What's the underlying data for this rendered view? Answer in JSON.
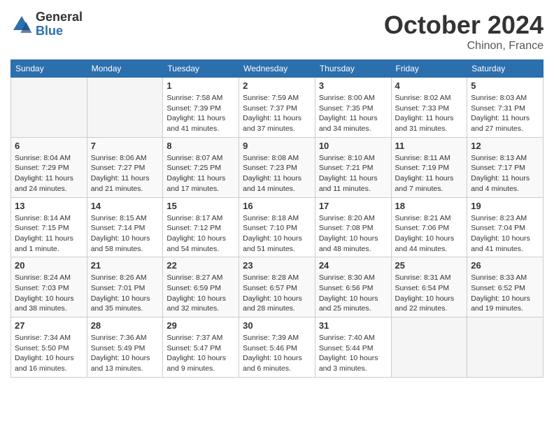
{
  "header": {
    "logo_general": "General",
    "logo_blue": "Blue",
    "month_year": "October 2024",
    "location": "Chinon, France"
  },
  "days_of_week": [
    "Sunday",
    "Monday",
    "Tuesday",
    "Wednesday",
    "Thursday",
    "Friday",
    "Saturday"
  ],
  "weeks": [
    [
      {
        "day": "",
        "empty": true
      },
      {
        "day": "",
        "empty": true
      },
      {
        "day": "1",
        "sunrise": "Sunrise: 7:58 AM",
        "sunset": "Sunset: 7:39 PM",
        "daylight": "Daylight: 11 hours and 41 minutes."
      },
      {
        "day": "2",
        "sunrise": "Sunrise: 7:59 AM",
        "sunset": "Sunset: 7:37 PM",
        "daylight": "Daylight: 11 hours and 37 minutes."
      },
      {
        "day": "3",
        "sunrise": "Sunrise: 8:00 AM",
        "sunset": "Sunset: 7:35 PM",
        "daylight": "Daylight: 11 hours and 34 minutes."
      },
      {
        "day": "4",
        "sunrise": "Sunrise: 8:02 AM",
        "sunset": "Sunset: 7:33 PM",
        "daylight": "Daylight: 11 hours and 31 minutes."
      },
      {
        "day": "5",
        "sunrise": "Sunrise: 8:03 AM",
        "sunset": "Sunset: 7:31 PM",
        "daylight": "Daylight: 11 hours and 27 minutes."
      }
    ],
    [
      {
        "day": "6",
        "sunrise": "Sunrise: 8:04 AM",
        "sunset": "Sunset: 7:29 PM",
        "daylight": "Daylight: 11 hours and 24 minutes."
      },
      {
        "day": "7",
        "sunrise": "Sunrise: 8:06 AM",
        "sunset": "Sunset: 7:27 PM",
        "daylight": "Daylight: 11 hours and 21 minutes."
      },
      {
        "day": "8",
        "sunrise": "Sunrise: 8:07 AM",
        "sunset": "Sunset: 7:25 PM",
        "daylight": "Daylight: 11 hours and 17 minutes."
      },
      {
        "day": "9",
        "sunrise": "Sunrise: 8:08 AM",
        "sunset": "Sunset: 7:23 PM",
        "daylight": "Daylight: 11 hours and 14 minutes."
      },
      {
        "day": "10",
        "sunrise": "Sunrise: 8:10 AM",
        "sunset": "Sunset: 7:21 PM",
        "daylight": "Daylight: 11 hours and 11 minutes."
      },
      {
        "day": "11",
        "sunrise": "Sunrise: 8:11 AM",
        "sunset": "Sunset: 7:19 PM",
        "daylight": "Daylight: 11 hours and 7 minutes."
      },
      {
        "day": "12",
        "sunrise": "Sunrise: 8:13 AM",
        "sunset": "Sunset: 7:17 PM",
        "daylight": "Daylight: 11 hours and 4 minutes."
      }
    ],
    [
      {
        "day": "13",
        "sunrise": "Sunrise: 8:14 AM",
        "sunset": "Sunset: 7:15 PM",
        "daylight": "Daylight: 11 hours and 1 minute."
      },
      {
        "day": "14",
        "sunrise": "Sunrise: 8:15 AM",
        "sunset": "Sunset: 7:14 PM",
        "daylight": "Daylight: 10 hours and 58 minutes."
      },
      {
        "day": "15",
        "sunrise": "Sunrise: 8:17 AM",
        "sunset": "Sunset: 7:12 PM",
        "daylight": "Daylight: 10 hours and 54 minutes."
      },
      {
        "day": "16",
        "sunrise": "Sunrise: 8:18 AM",
        "sunset": "Sunset: 7:10 PM",
        "daylight": "Daylight: 10 hours and 51 minutes."
      },
      {
        "day": "17",
        "sunrise": "Sunrise: 8:20 AM",
        "sunset": "Sunset: 7:08 PM",
        "daylight": "Daylight: 10 hours and 48 minutes."
      },
      {
        "day": "18",
        "sunrise": "Sunrise: 8:21 AM",
        "sunset": "Sunset: 7:06 PM",
        "daylight": "Daylight: 10 hours and 44 minutes."
      },
      {
        "day": "19",
        "sunrise": "Sunrise: 8:23 AM",
        "sunset": "Sunset: 7:04 PM",
        "daylight": "Daylight: 10 hours and 41 minutes."
      }
    ],
    [
      {
        "day": "20",
        "sunrise": "Sunrise: 8:24 AM",
        "sunset": "Sunset: 7:03 PM",
        "daylight": "Daylight: 10 hours and 38 minutes."
      },
      {
        "day": "21",
        "sunrise": "Sunrise: 8:26 AM",
        "sunset": "Sunset: 7:01 PM",
        "daylight": "Daylight: 10 hours and 35 minutes."
      },
      {
        "day": "22",
        "sunrise": "Sunrise: 8:27 AM",
        "sunset": "Sunset: 6:59 PM",
        "daylight": "Daylight: 10 hours and 32 minutes."
      },
      {
        "day": "23",
        "sunrise": "Sunrise: 8:28 AM",
        "sunset": "Sunset: 6:57 PM",
        "daylight": "Daylight: 10 hours and 28 minutes."
      },
      {
        "day": "24",
        "sunrise": "Sunrise: 8:30 AM",
        "sunset": "Sunset: 6:56 PM",
        "daylight": "Daylight: 10 hours and 25 minutes."
      },
      {
        "day": "25",
        "sunrise": "Sunrise: 8:31 AM",
        "sunset": "Sunset: 6:54 PM",
        "daylight": "Daylight: 10 hours and 22 minutes."
      },
      {
        "day": "26",
        "sunrise": "Sunrise: 8:33 AM",
        "sunset": "Sunset: 6:52 PM",
        "daylight": "Daylight: 10 hours and 19 minutes."
      }
    ],
    [
      {
        "day": "27",
        "sunrise": "Sunrise: 7:34 AM",
        "sunset": "Sunset: 5:50 PM",
        "daylight": "Daylight: 10 hours and 16 minutes."
      },
      {
        "day": "28",
        "sunrise": "Sunrise: 7:36 AM",
        "sunset": "Sunset: 5:49 PM",
        "daylight": "Daylight: 10 hours and 13 minutes."
      },
      {
        "day": "29",
        "sunrise": "Sunrise: 7:37 AM",
        "sunset": "Sunset: 5:47 PM",
        "daylight": "Daylight: 10 hours and 9 minutes."
      },
      {
        "day": "30",
        "sunrise": "Sunrise: 7:39 AM",
        "sunset": "Sunset: 5:46 PM",
        "daylight": "Daylight: 10 hours and 6 minutes."
      },
      {
        "day": "31",
        "sunrise": "Sunrise: 7:40 AM",
        "sunset": "Sunset: 5:44 PM",
        "daylight": "Daylight: 10 hours and 3 minutes."
      },
      {
        "day": "",
        "empty": true
      },
      {
        "day": "",
        "empty": true
      }
    ]
  ]
}
